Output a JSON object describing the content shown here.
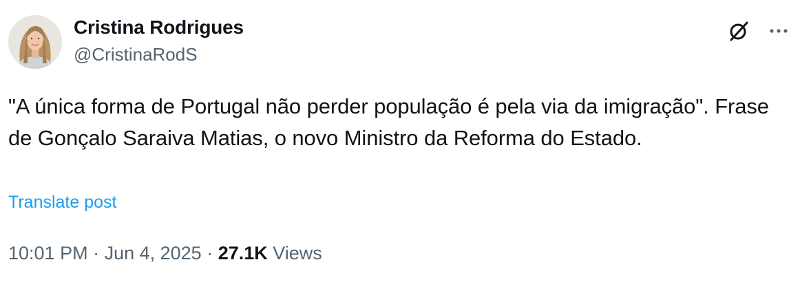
{
  "author": {
    "display_name": "Cristina Rodrigues",
    "handle": "@CristinaRodS"
  },
  "icons": {
    "grok": "grok-icon",
    "more": "more-icon"
  },
  "post": {
    "text": "\"A única forma de Portugal não perder população é pela via da imigração\". Frase de Gonçalo Saraiva Matias, o novo Ministro da Reforma do Estado.",
    "translate_label": "Translate post"
  },
  "meta": {
    "time": "10:01 PM",
    "separator": " · ",
    "date": "Jun 4, 2025",
    "views_count": "27.1K",
    "views_label": " Views"
  },
  "colors": {
    "text": "#0f1419",
    "secondary": "#536471",
    "link": "#1d9bf0"
  }
}
